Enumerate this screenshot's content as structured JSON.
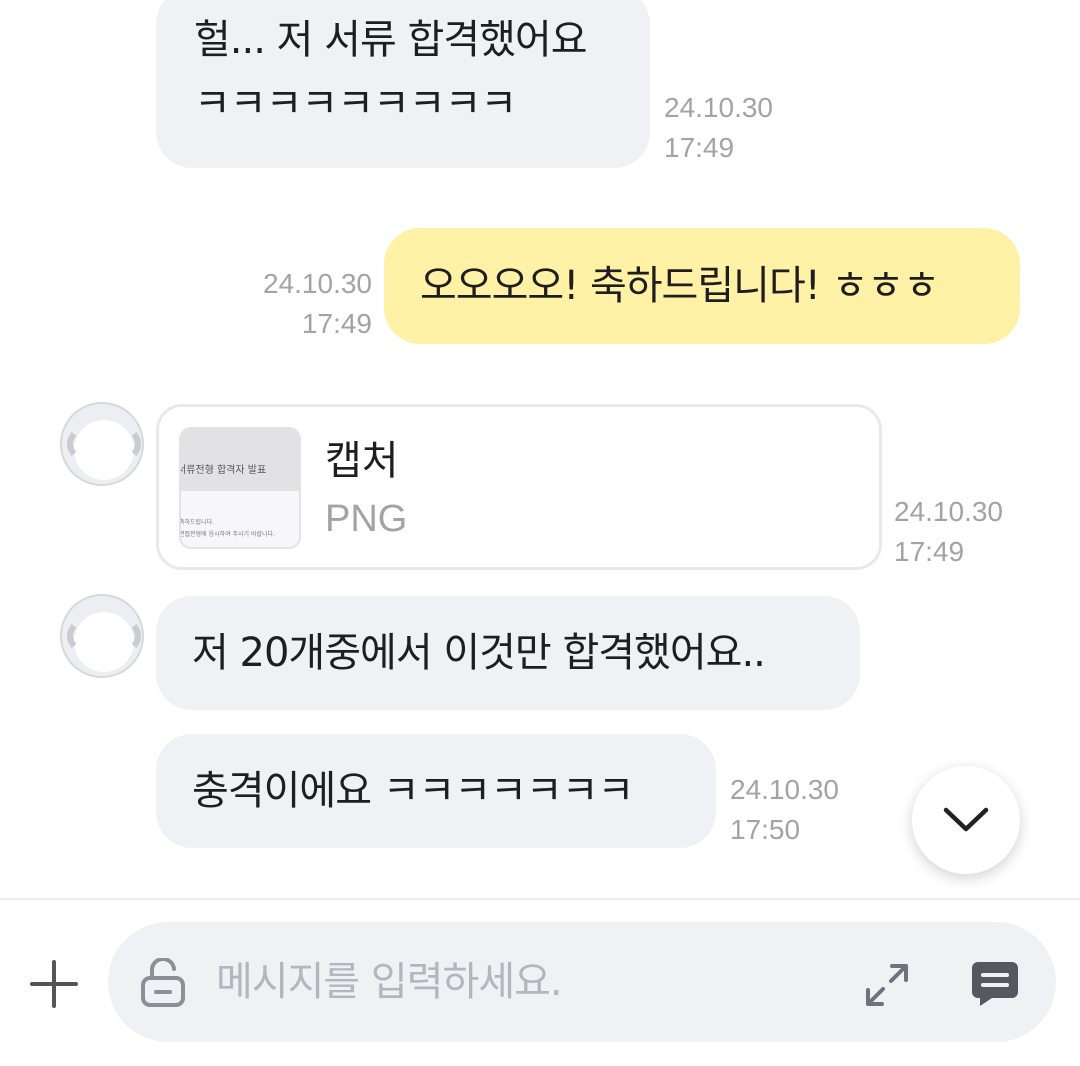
{
  "messages": [
    {
      "sender": "other",
      "lines": [
        "헐... 저 서류 합격했어요",
        "ㅋㅋㅋㅋㅋㅋㅋㅋㅋ"
      ],
      "date": "24.10.30",
      "time": "17:49"
    },
    {
      "sender": "me",
      "text": "오오오오! 축하드립니다! ㅎㅎㅎ",
      "date": "24.10.30",
      "time": "17:49"
    },
    {
      "sender": "other",
      "type": "file",
      "file_name": "캡처",
      "file_type": "PNG",
      "thumbnail": {
        "title": "서류전형 합격자 발표",
        "line1": "축하드립니다.",
        "line2": "면접전형에 응시하여 주시기 바랍니다."
      },
      "date": "24.10.30",
      "time": "17:49"
    },
    {
      "sender": "other",
      "text": "저 20개중에서 이것만 합격했어요.."
    },
    {
      "sender": "other",
      "text": "충격이에요 ㅋㅋㅋㅋㅋㅋㅋ",
      "date": "24.10.30",
      "time": "17:50"
    }
  ],
  "input": {
    "placeholder": "메시지를 입력하세요.",
    "value": ""
  },
  "icons": {
    "scroll_down": "chevron-down-icon",
    "attach": "plus-icon",
    "lock": "unlock-icon",
    "expand": "expand-icon",
    "emoticon": "message-icon"
  },
  "colors": {
    "my_bubble": "#fff1a6",
    "other_bubble": "#f0f1f5",
    "timestamp": "#a3a3a3"
  }
}
